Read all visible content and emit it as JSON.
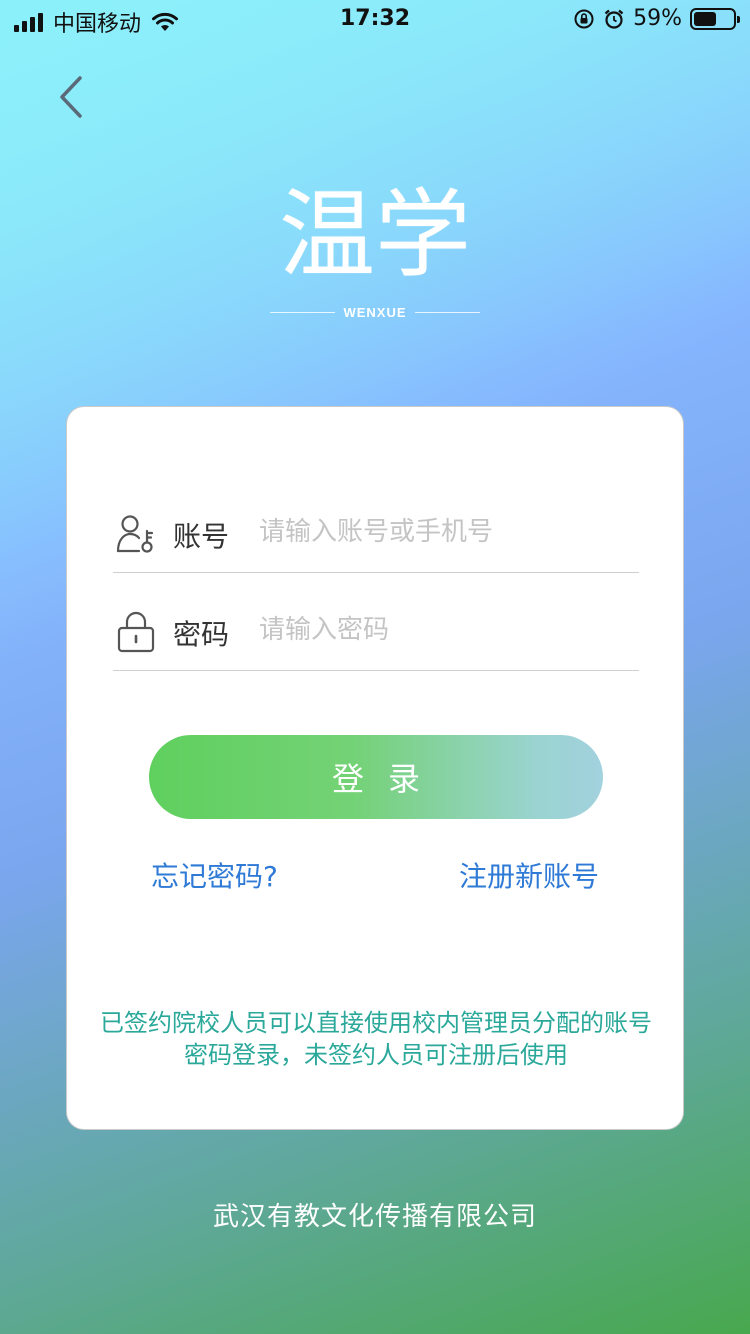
{
  "status_bar": {
    "carrier": "中国移动",
    "time": "17:32",
    "battery_percent": "59%",
    "battery_level": 0.59
  },
  "logo": {
    "title_cn": "温学",
    "title_en": "WENXUE"
  },
  "form": {
    "account_label": "账号",
    "account_placeholder": "请输入账号或手机号",
    "password_label": "密码",
    "password_placeholder": "请输入密码",
    "login_label": "登录",
    "forgot_label": "忘记密码?",
    "register_label": "注册新账号",
    "note": "已签约院校人员可以直接使用校内管理员分配的账号密码登录，未签约人员可注册后使用"
  },
  "footer": {
    "company": "武汉有教文化传播有限公司"
  },
  "colors": {
    "link": "#2e7ad6",
    "note": "#2aa89a",
    "button_start": "#5fd05e",
    "button_end": "#a2d2de"
  }
}
